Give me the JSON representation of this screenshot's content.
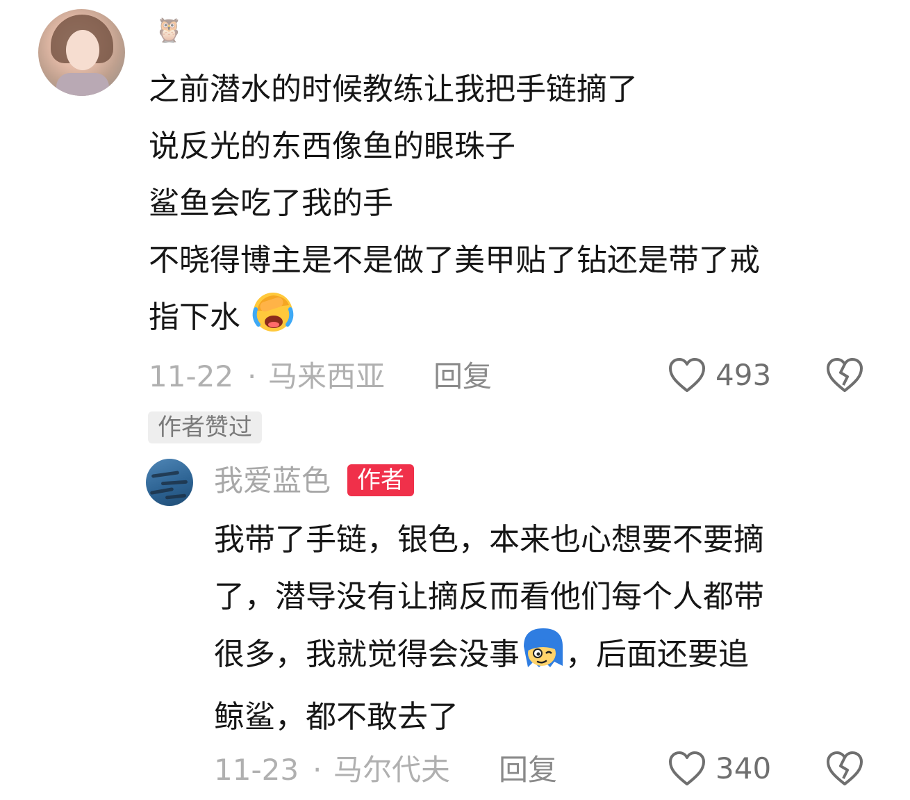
{
  "comment": {
    "lines": [
      "之前潜水的时候教练让我把手链摘了",
      "说反光的东西像鱼的眼珠子",
      "鲨鱼会吃了我的手",
      "不晓得博主是不是做了美甲贴了钻还是带了戒",
      "指下水"
    ],
    "emoji": "facepalm-crying-emoji",
    "date": "11-22",
    "separator": "·",
    "location": "马来西亚",
    "reply_label": "回复",
    "like_count": "493",
    "author_liked_badge": "作者赞过"
  },
  "reply": {
    "username": "我爱蓝色",
    "author_tag": "作者",
    "lines": [
      "我带了手链，银色，本来也心想要不要摘",
      "了，潜导没有让摘反而看他们每个人都带",
      "很多，我就觉得会没事",
      "，后面还要追",
      "鲸鲨，都不敢去了"
    ],
    "emoji": "blue-hair-wink-emoji",
    "date": "11-23",
    "separator": "·",
    "location": "马尔代夫",
    "reply_label": "回复",
    "like_count": "340"
  },
  "colors": {
    "text": "#161616",
    "meta": "#b0b0b0",
    "author_tag_bg": "#f0304a",
    "badge_bg": "#eeeeee"
  }
}
